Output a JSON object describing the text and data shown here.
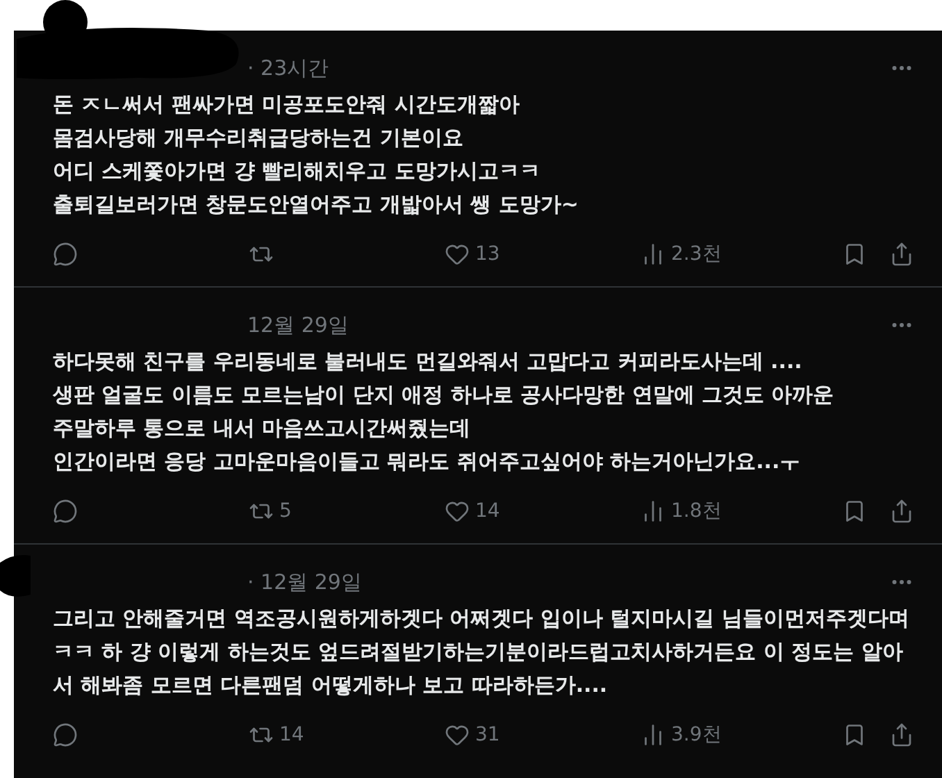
{
  "posts": [
    {
      "time": "· 23시간",
      "text": "돈 ㅈㄴ써서 팬싸가면 미공포도안줘 시간도개짧아\n몸검사당해 개무수리취급당하는건 기본이요\n어디 스케쫓아가면 걍 빨리해치우고 도망가시고ㅋㅋ\n출퇴길보러가면 창문도안열어주고 개밟아서 쌩 도망가~",
      "stats": [
        {
          "kind": "reply"
        },
        {
          "kind": "repost"
        },
        {
          "kind": "like",
          "count": "13"
        },
        {
          "kind": "views",
          "count": "2.3천"
        }
      ]
    },
    {
      "time": "12월 29일",
      "text": "하다못해 친구를 우리동네로 불러내도 먼길와줘서 고맙다고 커피라도사는데 ....\n생판 얼굴도 이름도 모르는남이 단지 애정 하나로 공사다망한 연말에 그것도 아까운\n주말하루 통으로 내서 마음쓰고시간써줬는데\n인간이라면 응당 고마운마음이들고 뭐라도 쥐어주고싶어야 하는거아닌가요...ㅜ",
      "stats": [
        {
          "kind": "reply"
        },
        {
          "kind": "repost",
          "count": "5"
        },
        {
          "kind": "like",
          "count": "14"
        },
        {
          "kind": "views",
          "count": "1.8천"
        }
      ]
    },
    {
      "time": "· 12월 29일",
      "text": "그리고 안해줄거면 역조공시원하게하겟다 어쩌겟다 입이나 털지마시길 님들이먼저주겟다며ㅋㅋ 하 걍 이렇게 하는것도 엎드려절받기하는기분이라드럽고치사하거든요 이 정도는 알아서 해봐좀 모르면 다른팬덤 어떻게하나 보고 따라하든가....",
      "stats": [
        {
          "kind": "reply"
        },
        {
          "kind": "repost",
          "count": "14"
        },
        {
          "kind": "like",
          "count": "31"
        },
        {
          "kind": "views",
          "count": "3.9천"
        }
      ]
    }
  ]
}
